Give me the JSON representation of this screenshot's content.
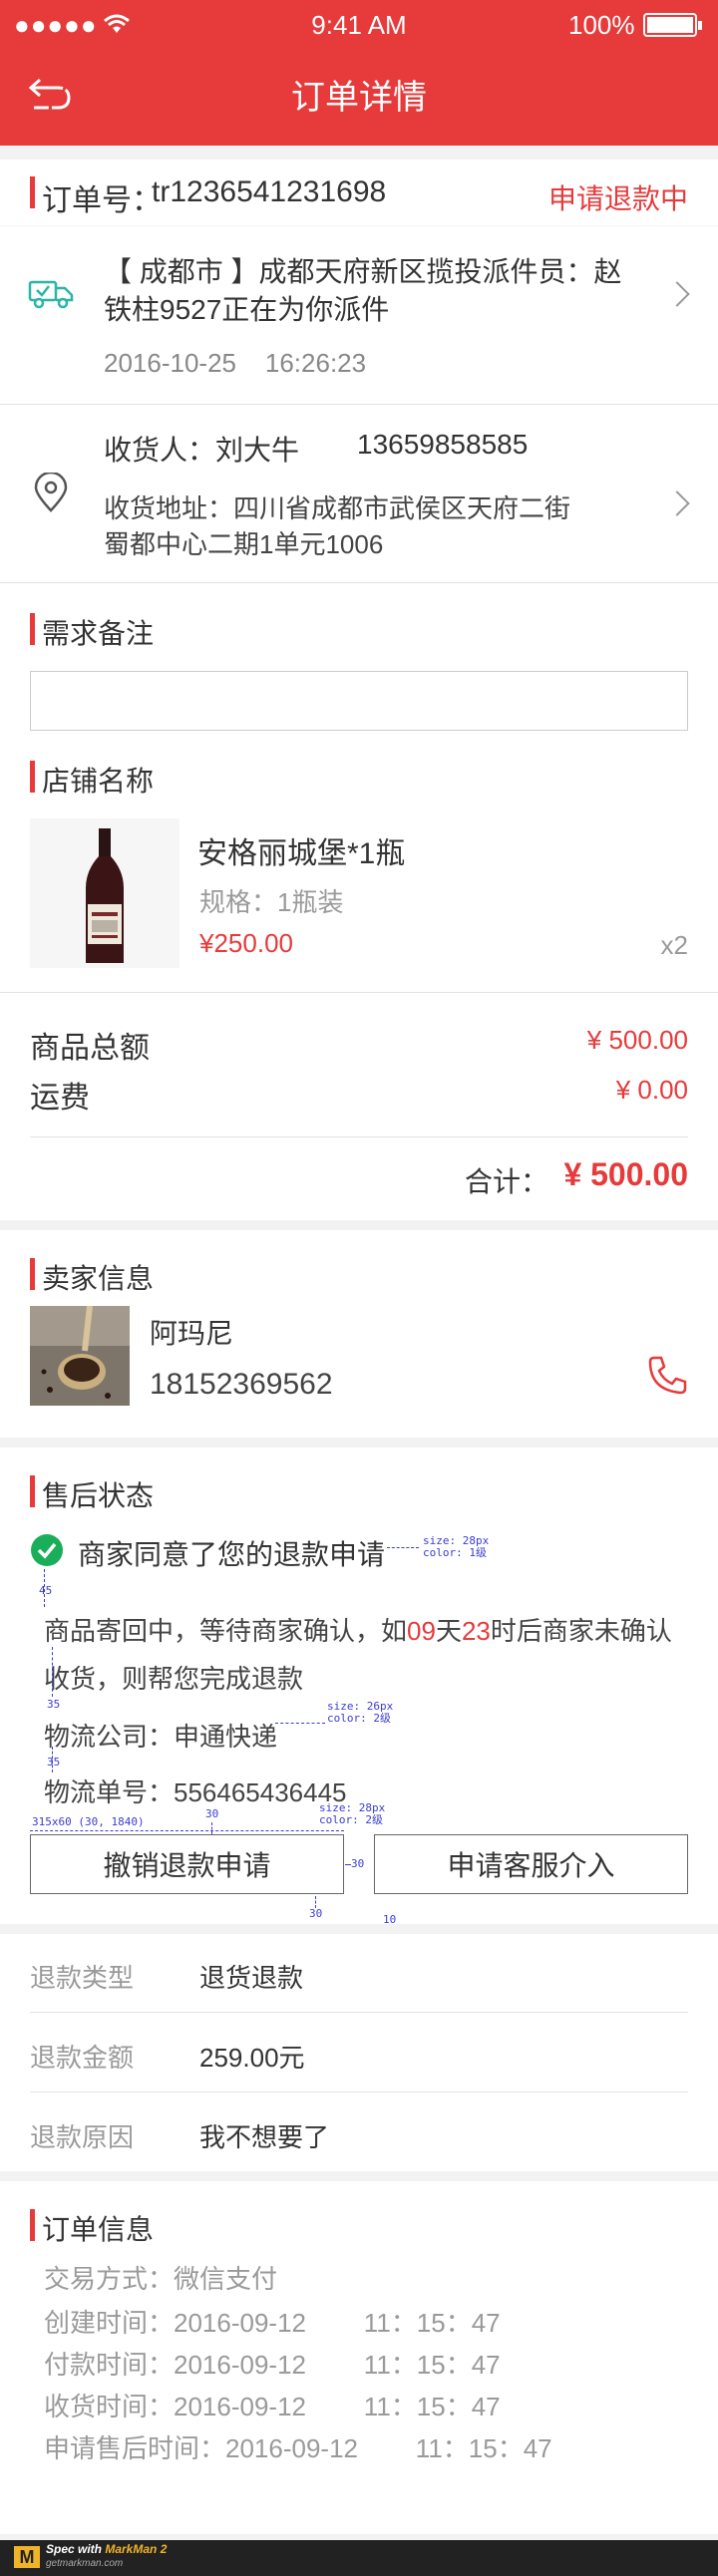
{
  "status_bar": {
    "signal": "●●●●●",
    "time": "9:41 AM",
    "battery": "100%"
  },
  "nav": {
    "title": "订单详情"
  },
  "order": {
    "number_label": "订单号：",
    "number": "tr1236541231698",
    "status": "申请退款中"
  },
  "logistics": {
    "text": "【 成都市 】成都天府新区揽投派件员：赵铁柱9527正在为你派件",
    "line1": "【 成都市 】成都天府新区揽投派件员：赵",
    "line2": "铁柱9527正在为你派件",
    "time": "2016-10-25    16:26:23"
  },
  "address": {
    "receiver": "收货人：刘大牛",
    "phone": "13659858585",
    "line1": "收货地址：四川省成都市武侯区天府二街",
    "line2": "蜀都中心二期1单元1006"
  },
  "remark": {
    "title": "需求备注",
    "placeholder": ""
  },
  "shop": {
    "title": "店铺名称"
  },
  "product": {
    "name": "安格丽城堡*1瓶",
    "spec": "规格：1瓶装",
    "price": "¥250.00",
    "qty": "x2"
  },
  "totals": {
    "goods_label": "商品总额",
    "goods_value": "¥ 500.00",
    "shipping_label": "运费",
    "shipping_value": "¥ 0.00",
    "sum_label": "合计：",
    "sum_value": "¥ 500.00"
  },
  "seller": {
    "title": "卖家信息",
    "name": "阿玛尼",
    "phone": "18152369562"
  },
  "after_sale": {
    "title": "售后状态",
    "status": "商家同意了您的退款申请",
    "desc_a": "商品寄回中，等待商家确认，如",
    "desc_days": "09",
    "desc_b": "天",
    "desc_hours": "23",
    "desc_c": "时后商家未确认",
    "desc_line2": "收货，则帮您完成退款",
    "company": "物流公司：申通快递",
    "tracking": "物流单号：556465436445",
    "btn_cancel": "撤销退款申请",
    "btn_service": "申请客服介入"
  },
  "refund": {
    "rows": [
      {
        "label": "退款类型",
        "value": "退货退款"
      },
      {
        "label": "退款金额",
        "value": "259.00元"
      },
      {
        "label": "退款原因",
        "value": "我不想要了"
      }
    ]
  },
  "order_info": {
    "title": "订单信息",
    "rows": [
      "交易方式：微信支付",
      "创建时间：2016-09-12        11：15：47",
      "付款时间：2016-09-12        11：15：47",
      "收货时间：2016-09-12        11：15：47",
      "申请售后时间：2016-09-12        11：15：47"
    ]
  },
  "annotations": {
    "a1": "size: 28px\ncolor: 1级",
    "a2": "45",
    "a3": "35",
    "a4": "size: 26px\ncolor: 2级",
    "a5": "35",
    "a6": "30",
    "a7": "size: 28px\ncolor: 2级",
    "a8": "315x60 (30, 1840)",
    "a9": "30",
    "a10": "30",
    "a11": "10"
  },
  "footer": {
    "brand": "Spec with MarkMan 2",
    "brand_prefix": "Spec with ",
    "brand_name": "MarkMan 2",
    "url": "getmarkman.com"
  },
  "colors": {
    "accent": "#e63a3b",
    "teal": "#2bb5a5",
    "green": "#1aad5a"
  }
}
